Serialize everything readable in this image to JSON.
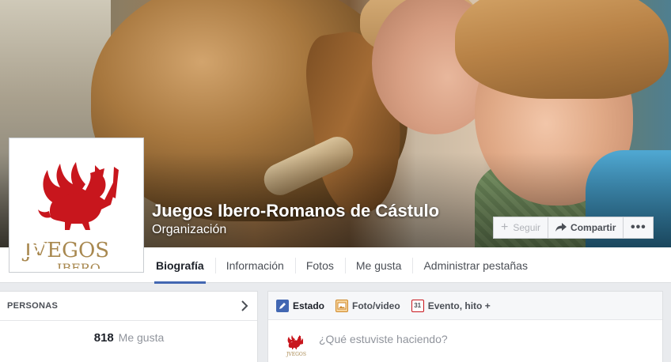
{
  "page": {
    "name": "Juegos Ibero-Romanos de Cástulo",
    "category": "Organización"
  },
  "profile": {
    "logo_text_1": "JVEGOS",
    "logo_text_2": "IBERO"
  },
  "cover_actions": {
    "follow_label": "Seguir",
    "share_label": "Compartir",
    "more_label": "•••"
  },
  "tabs": [
    {
      "label": "Biografía",
      "active": true
    },
    {
      "label": "Información",
      "active": false
    },
    {
      "label": "Fotos",
      "active": false
    },
    {
      "label": "Me gusta",
      "active": false
    },
    {
      "label": "Administrar pestañas",
      "active": false
    }
  ],
  "left_card": {
    "title": "PERSONAS",
    "likes_count": "818",
    "likes_label": "Me gusta"
  },
  "composer": {
    "tabs": [
      {
        "label": "Estado",
        "icon": "pencil-icon"
      },
      {
        "label": "Foto/video",
        "icon": "photo-icon"
      },
      {
        "label": "Evento, hito +",
        "icon": "calendar-icon",
        "calendar_number": "31"
      }
    ],
    "placeholder": "¿Qué estuviste haciendo?"
  },
  "colors": {
    "brand_blue": "#4267b2",
    "logo_red": "#c8161d",
    "logo_gold": "#a8884f"
  }
}
